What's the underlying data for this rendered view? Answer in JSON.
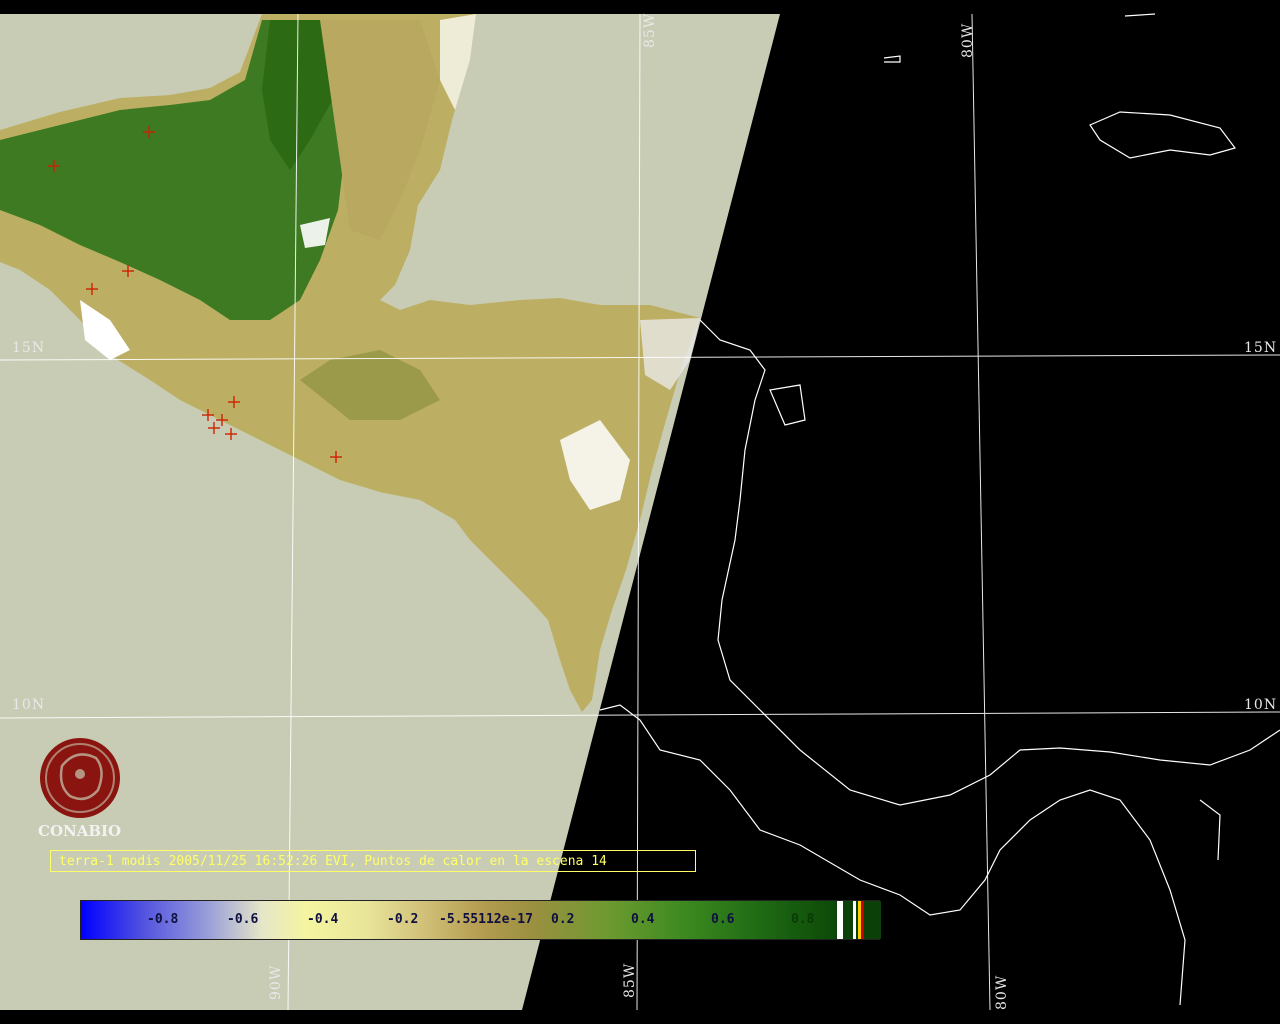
{
  "map": {
    "grid_labels": {
      "lon_85w": "85W",
      "lon_80w": "80W",
      "lon_90w": "90W",
      "lat_15n": "15N",
      "lat_10n": "10N"
    },
    "colors": {
      "outside_swath": "#c8ccb4",
      "night_side": "#000000",
      "coastline": "#ffffff",
      "grid": "#ffffff",
      "hotspot": "#cc2200",
      "caption": "#ffff66"
    },
    "hotspot_icon": "cross-icon"
  },
  "logo": {
    "icon": "conabio-logo-icon",
    "text": "CONABIO"
  },
  "caption": "terra-1 modis 2005/11/25 16:52:26 EVI, Puntos de calor en la escena 14",
  "colorbar": {
    "ticks": [
      "-0.8",
      "-0.6",
      "-0.4",
      "-0.2",
      "-5.55112e-17",
      "0.2",
      "0.4",
      "0.6",
      "0.8"
    ]
  }
}
